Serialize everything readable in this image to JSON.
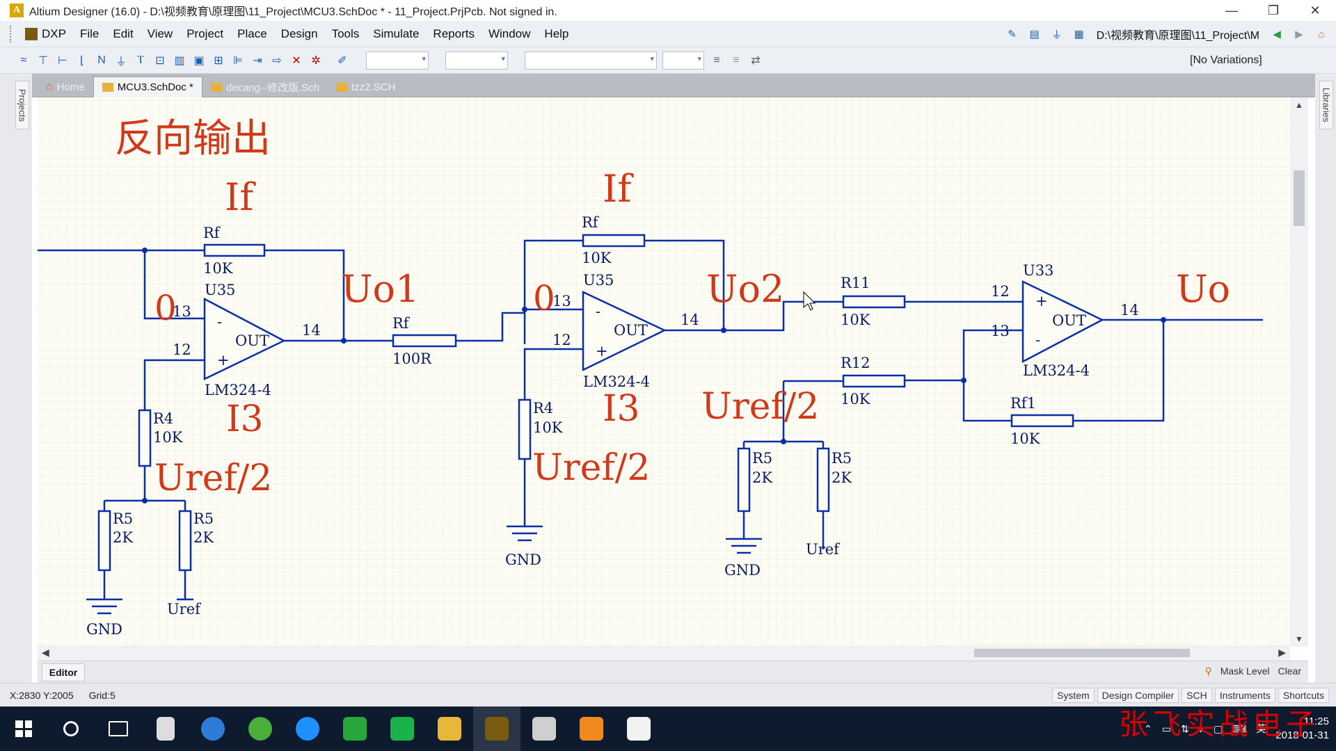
{
  "window": {
    "title": "Altium Designer (16.0) - D:\\视频教育\\原理图\\11_Project\\MCU3.SchDoc * - 11_Project.PrjPcb. Not signed in.",
    "icon": "altium-icon",
    "minimize": "—",
    "restore": "❐",
    "close": "✕"
  },
  "menu": {
    "items": [
      "DXP",
      "File",
      "Edit",
      "View",
      "Project",
      "Place",
      "Design",
      "Tools",
      "Simulate",
      "Reports",
      "Window",
      "Help"
    ],
    "path": "D:\\视频教育\\原理图\\11_Project\\M"
  },
  "toolbar": {
    "variations": "[No Variations]"
  },
  "tabs": [
    {
      "label": "Home",
      "icon": "home-icon"
    },
    {
      "label": "MCU3.SchDoc *",
      "icon": "schdoc-icon"
    },
    {
      "label": "decang--修改版.Sch",
      "icon": "sch-icon"
    },
    {
      "label": "tzz2.SCH",
      "icon": "sch-icon"
    }
  ],
  "side_panels": {
    "left": "Projects",
    "right": "Libraries"
  },
  "editor": {
    "tab": "Editor",
    "mask_level": "Mask Level",
    "clear": "Clear"
  },
  "status": {
    "coord": "X:2830 Y:2005",
    "grid": "Grid:5",
    "buttons": [
      "System",
      "Design Compiler",
      "SCH",
      "Instruments",
      "Shortcuts"
    ]
  },
  "taskbar": {
    "time": "11:25",
    "date": "2018-01-31",
    "ime": "英"
  },
  "watermark": "张飞实战电子",
  "schematic": {
    "annotations": {
      "heading": "反向输出",
      "if1": "If",
      "if2": "If",
      "uo1": "Uo1",
      "uo2": "Uo2",
      "uo": "Uo",
      "zero1": "0",
      "zero2": "0",
      "i3_1": "I3",
      "i3_2": "I3",
      "uref2_1": "Uref/2",
      "uref2_2": "Uref/2",
      "uref2_3": "Uref/2"
    },
    "labels": {
      "rf1": "Rf",
      "rf1_val": "10K",
      "u35a": "U35",
      "u35a_part": "LM324-4",
      "rf2": "Rf",
      "rf2_val": "100R",
      "rf3": "Rf",
      "rf3_val": "10K",
      "u35b": "U35",
      "u35b_part": "LM324-4",
      "r11": "R11",
      "r11_val": "10K",
      "r12": "R12",
      "r12_val": "10K",
      "u33": "U33",
      "u33_part": "LM324-4",
      "rfl": "Rf1",
      "rfl_val": "10K",
      "r4a": "R4",
      "r4a_val": "10K",
      "r4b": "R4",
      "r4b_val": "10K",
      "r5a": "R5",
      "r5a_val": "2K",
      "r5b": "R5",
      "r5b_val": "2K",
      "r5c": "R5",
      "r5c_val": "2K",
      "r5d": "R5",
      "r5d_val": "2K",
      "gnd1": "GND",
      "gnd2": "GND",
      "gnd3": "GND",
      "uref1": "Uref",
      "uref2": "Uref",
      "p13a": "13",
      "p12a": "12",
      "p14a": "14",
      "p13b": "13",
      "p12b": "12",
      "p14b": "14",
      "p12c": "12",
      "p13c": "13",
      "p14c": "14",
      "out": "OUT",
      "minus": "-",
      "plus": "+"
    }
  }
}
